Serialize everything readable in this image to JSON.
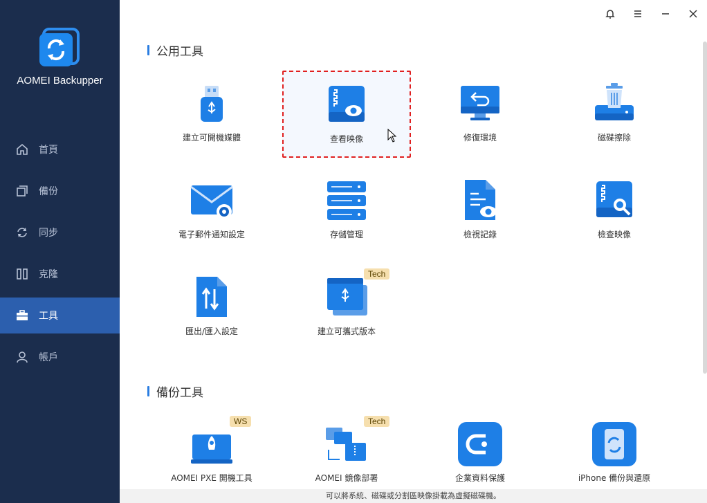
{
  "app": {
    "name": "AOMEI Backupper"
  },
  "sidebar": {
    "items": [
      {
        "label": "首頁",
        "icon": "home-icon",
        "active": false
      },
      {
        "label": "備份",
        "icon": "backup-icon",
        "active": false
      },
      {
        "label": "同步",
        "icon": "sync-icon",
        "active": false
      },
      {
        "label": "克隆",
        "icon": "clone-icon",
        "active": false
      },
      {
        "label": "工具",
        "icon": "toolbox-icon",
        "active": true
      },
      {
        "label": "帳戶",
        "icon": "user-icon",
        "active": false
      }
    ]
  },
  "window_controls": {
    "icons": [
      "bell-icon",
      "menu-icon",
      "minimize-icon",
      "close-icon"
    ]
  },
  "sections": {
    "public_tools": {
      "title": "公用工具",
      "tools": [
        {
          "label": "建立可開機媒體",
          "icon": "usb-icon"
        },
        {
          "label": "查看映像",
          "icon": "explore-image-icon",
          "selected": true
        },
        {
          "label": "修復環境",
          "icon": "recovery-env-icon"
        },
        {
          "label": "磁碟擦除",
          "icon": "disk-wipe-icon"
        },
        {
          "label": "電子郵件通知設定",
          "icon": "email-settings-icon"
        },
        {
          "label": "存儲管理",
          "icon": "storage-icon"
        },
        {
          "label": "檢視記錄",
          "icon": "logs-icon"
        },
        {
          "label": "檢查映像",
          "icon": "check-image-icon"
        },
        {
          "label": "匯出/匯入設定",
          "icon": "export-import-icon"
        },
        {
          "label": "建立可攜式版本",
          "icon": "portable-icon",
          "badge": "Tech"
        }
      ]
    },
    "backup_tools": {
      "title": "備份工具",
      "tools": [
        {
          "label": "AOMEI PXE 開機工具",
          "icon": "pxe-icon",
          "badge": "WS"
        },
        {
          "label": "AOMEI 鏡像部署",
          "icon": "image-deploy-icon",
          "badge": "Tech"
        },
        {
          "label": "企業資料保護",
          "icon": "centralized-backup-icon"
        },
        {
          "label": "iPhone 備份與還原",
          "icon": "iphone-backup-icon"
        }
      ]
    }
  },
  "status": {
    "text": "可以將系統、磁碟或分割區映像掛載為虛擬磁碟機。"
  },
  "colors": {
    "sidebar": "#1b2d4d",
    "active": "#2c5fae",
    "accent": "#2a7de1"
  }
}
